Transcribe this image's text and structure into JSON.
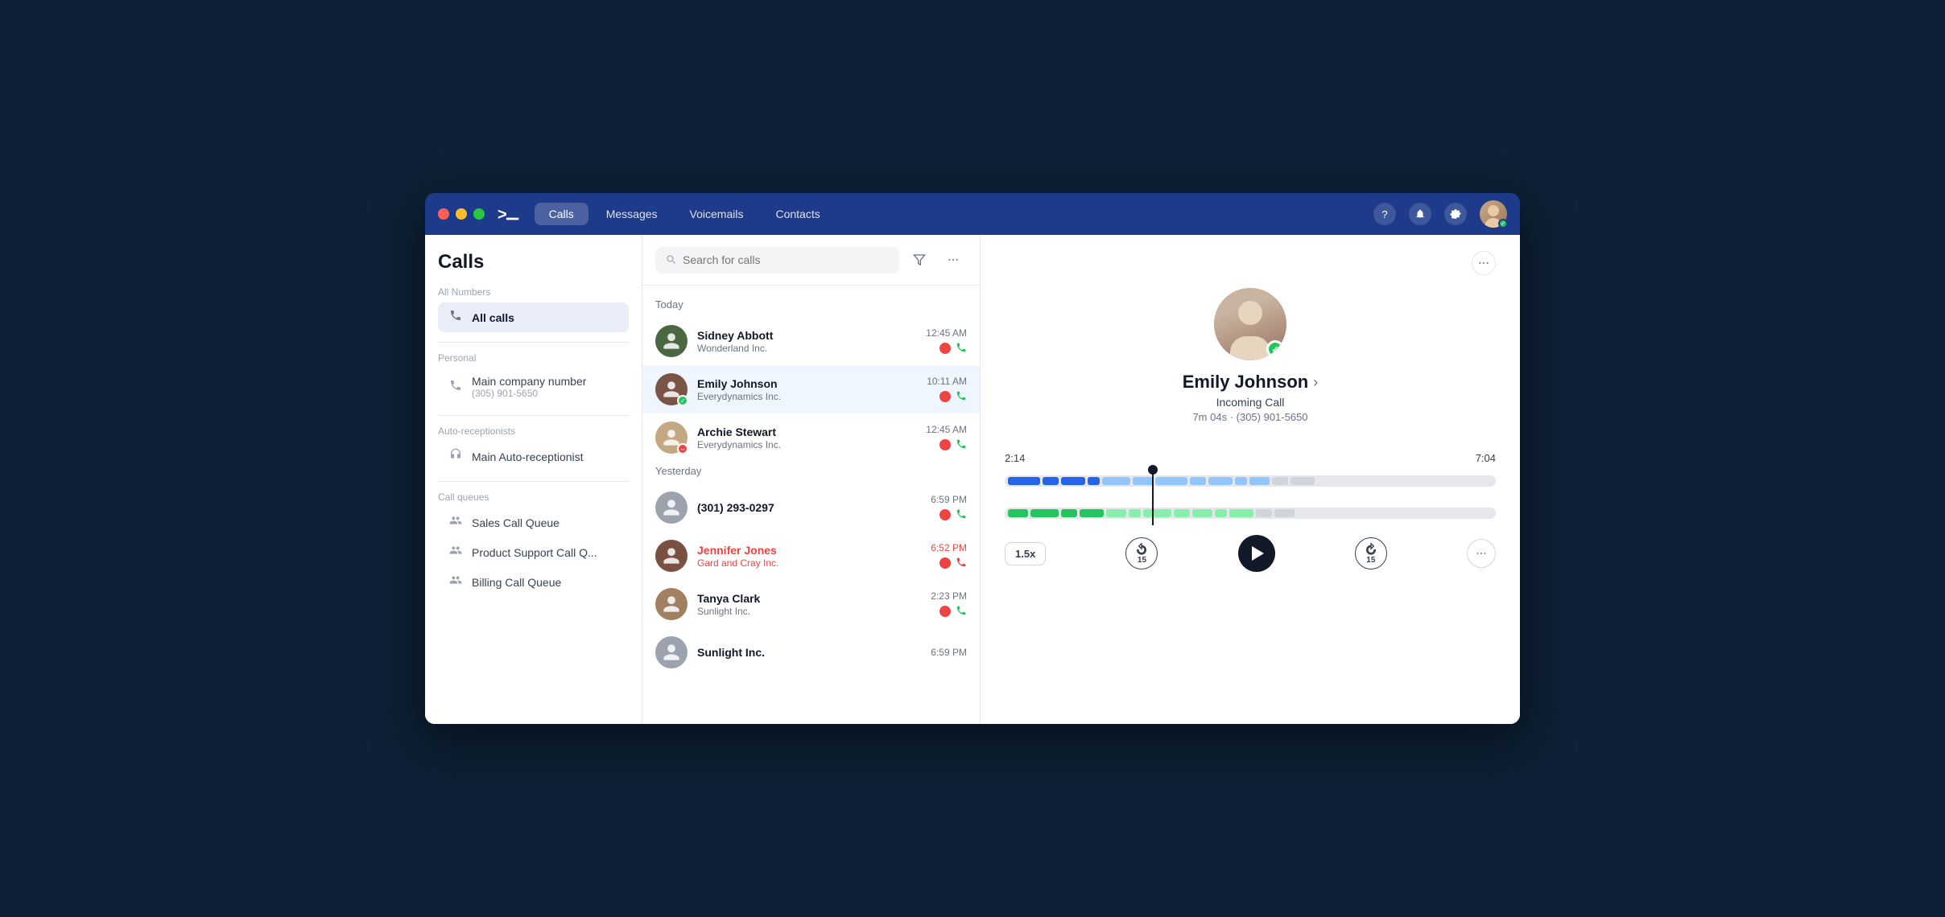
{
  "window": {
    "title": "Calls"
  },
  "titlebar": {
    "nav_tabs": [
      "Calls",
      "Messages",
      "Voicemails",
      "Contacts"
    ],
    "active_tab": "Calls",
    "icons": {
      "help": "?",
      "notifications": "🔔",
      "settings": "⚙"
    }
  },
  "sidebar": {
    "title": "Calls",
    "all_numbers_label": "All Numbers",
    "all_calls_label": "All calls",
    "personal_label": "Personal",
    "personal_items": [
      {
        "name": "Main company number",
        "sub": "(305) 901-5650"
      }
    ],
    "auto_receptionists_label": "Auto-receptionists",
    "auto_receptionist_items": [
      {
        "name": "Main Auto-receptionist"
      }
    ],
    "call_queues_label": "Call queues",
    "call_queue_items": [
      {
        "name": "Sales Call Queue"
      },
      {
        "name": "Product Support Call Q..."
      },
      {
        "name": "Billing Call Queue"
      }
    ]
  },
  "calls_panel": {
    "search_placeholder": "Search for calls",
    "today_label": "Today",
    "yesterday_label": "Yesterday",
    "calls": [
      {
        "id": 1,
        "name": "Sidney Abbott",
        "company": "Wonderland Inc.",
        "time": "12:45 AM",
        "avatar_color": "#4a6741",
        "has_recording": true,
        "missed": false,
        "active": false,
        "badge_color": "none"
      },
      {
        "id": 2,
        "name": "Emily Johnson",
        "company": "Everydynamics Inc.",
        "time": "10:11 AM",
        "avatar_color": "#7a5545",
        "has_recording": true,
        "missed": false,
        "active": true,
        "badge_color": "green"
      },
      {
        "id": 3,
        "name": "Archie Stewart",
        "company": "Everydynamics Inc.",
        "time": "12:45 AM",
        "avatar_color": "#c4a882",
        "has_recording": true,
        "missed": false,
        "active": false,
        "badge_color": "red"
      },
      {
        "id": 4,
        "name": "(301) 293-0297",
        "company": "",
        "time": "6:59 PM",
        "avatar_color": "#9ca3af",
        "has_recording": true,
        "missed": false,
        "active": false,
        "badge_color": "none",
        "is_number": true
      },
      {
        "id": 5,
        "name": "Jennifer Jones",
        "company": "Gard and Cray Inc.",
        "time": "6:52 PM",
        "avatar_color": "#7a5040",
        "has_recording": true,
        "missed": true,
        "active": false,
        "badge_color": "none"
      },
      {
        "id": 6,
        "name": "Tanya Clark",
        "company": "Sunlight Inc.",
        "time": "2:23 PM",
        "avatar_color": "#a08060",
        "has_recording": true,
        "missed": false,
        "active": false,
        "badge_color": "none"
      },
      {
        "id": 7,
        "name": "Sunlight Inc.",
        "company": "",
        "time": "6:59 PM",
        "avatar_color": "#9ca3af",
        "has_recording": false,
        "missed": false,
        "active": false,
        "badge_color": "none"
      }
    ]
  },
  "detail": {
    "contact_name": "Emily Johnson",
    "call_type": "Incoming Call",
    "duration": "7m 04s · (305) 901-5650",
    "current_time": "2:14",
    "end_time": "7:04",
    "speed": "1.5x",
    "skip_back": "15",
    "skip_forward": "15",
    "more_options": "···",
    "progress_percent": 30
  }
}
